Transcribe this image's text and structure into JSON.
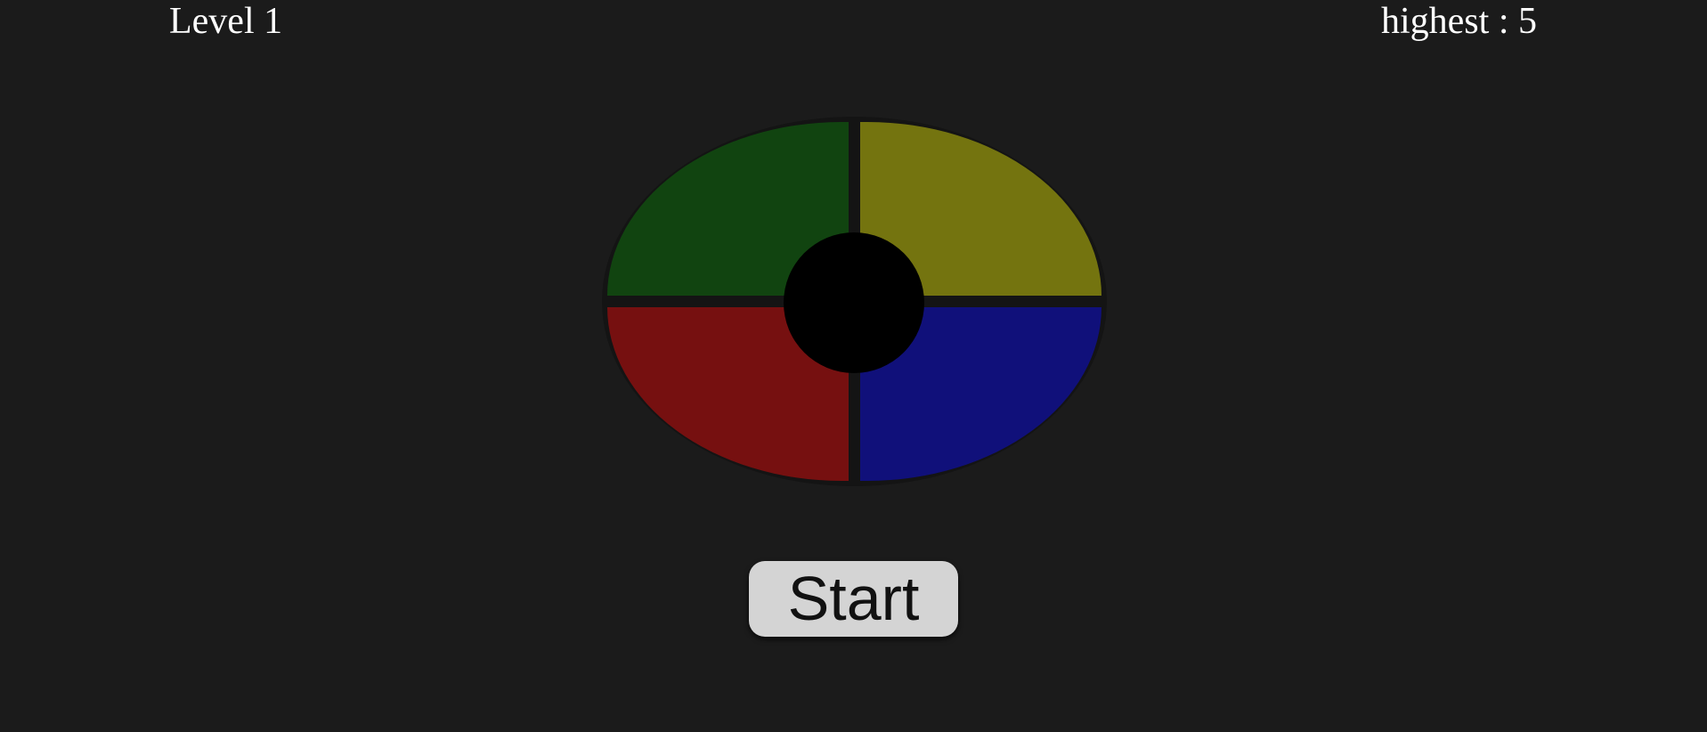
{
  "header": {
    "level_text": "Level 1",
    "highest_text": "highest : 5"
  },
  "board": {
    "pads": [
      {
        "name": "green",
        "color": "#114410"
      },
      {
        "name": "yellow",
        "color": "#74740f"
      },
      {
        "name": "red",
        "color": "#761010"
      },
      {
        "name": "blue",
        "color": "#10107a"
      }
    ],
    "center_color": "#000000"
  },
  "controls": {
    "start_label": "Start"
  },
  "colors": {
    "background": "#1b1b1b",
    "text": "#ffffff",
    "button_bg": "#d4d4d4"
  }
}
